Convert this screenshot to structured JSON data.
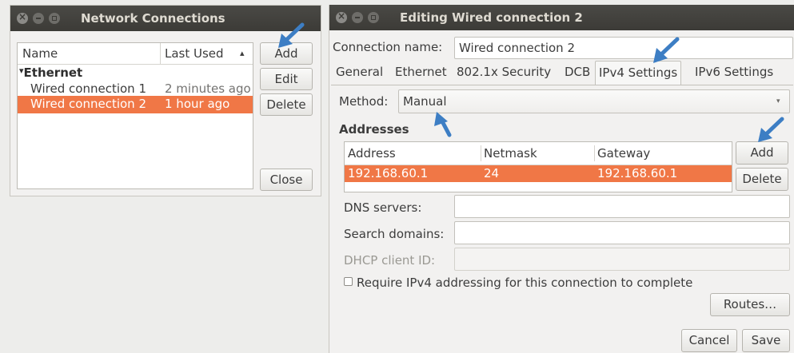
{
  "network_window": {
    "title": "Network Connections",
    "columns": [
      "Name",
      "Last Used"
    ],
    "sort_indicator": "▴",
    "group": "Ethernet",
    "rows": [
      {
        "name": "Wired connection 1",
        "last_used": "2 minutes ago"
      },
      {
        "name": "Wired connection 2",
        "last_used": "1 hour ago"
      }
    ],
    "buttons": {
      "add": "Add",
      "edit": "Edit",
      "delete": "Delete",
      "close": "Close"
    }
  },
  "edit_window": {
    "title": "Editing Wired connection 2",
    "connection_name_label": "Connection name:",
    "connection_name_value": "Wired connection 2",
    "tabs": [
      "General",
      "Ethernet",
      "802.1x Security",
      "DCB",
      "IPv4 Settings",
      "IPv6 Settings"
    ],
    "active_tab": "IPv4 Settings",
    "method_label": "Method:",
    "method_value": "Manual",
    "addresses_heading": "Addresses",
    "address_columns": [
      "Address",
      "Netmask",
      "Gateway"
    ],
    "address_rows": [
      {
        "address": "192.168.60.1",
        "netmask": "24",
        "gateway": "192.168.60.1"
      }
    ],
    "address_buttons": {
      "add": "Add",
      "delete": "Delete"
    },
    "dns_label": "DNS servers:",
    "search_label": "Search domains:",
    "dhcp_label": "DHCP client ID:",
    "require_label": "Require IPv4 addressing for this connection to complete",
    "routes_button": "Routes…",
    "cancel_button": "Cancel",
    "save_button": "Save"
  },
  "colors": {
    "selection": "#f07746",
    "titlebar": "#3c3b37",
    "arrow": "#3d7ec4"
  }
}
